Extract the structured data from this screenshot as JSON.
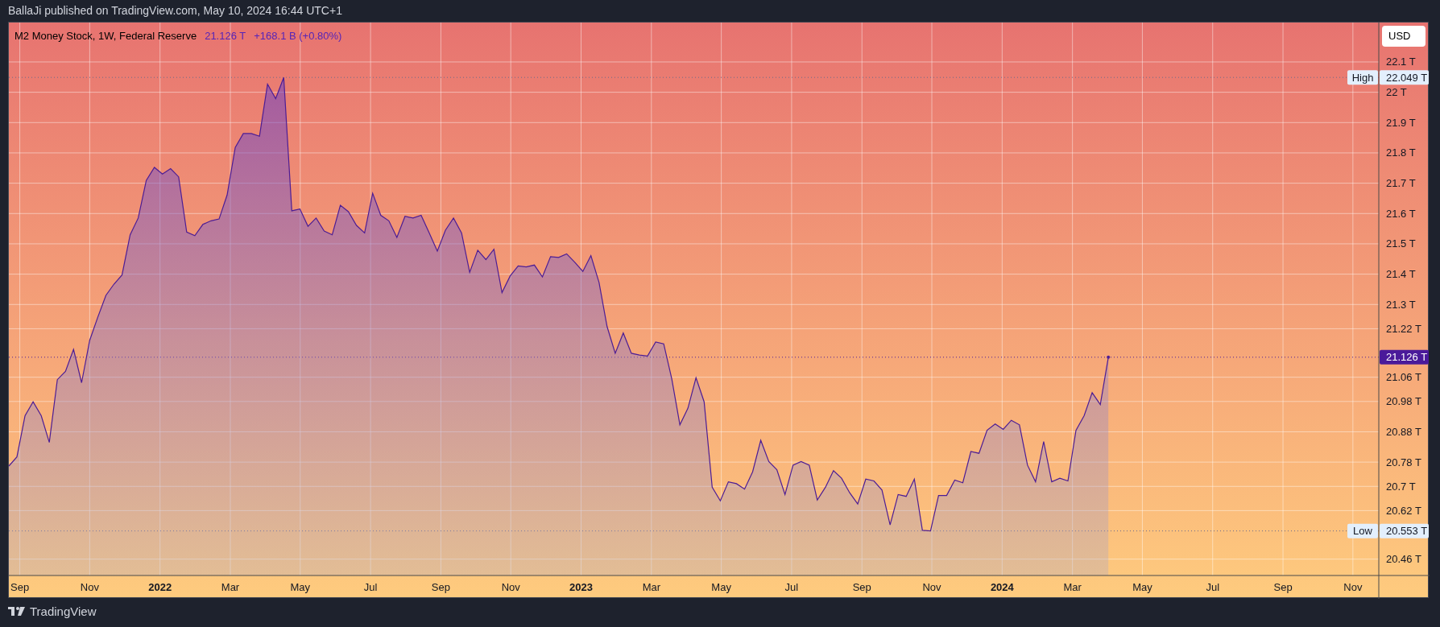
{
  "header": {
    "publisher_line": "BallaJi published on TradingView.com, May 10, 2024 16:44 UTC+1"
  },
  "chart": {
    "legend": {
      "last_value": "21.126 T",
      "change": "+168.1 B (+0.80%)"
    },
    "currency_button": "USD",
    "chart_data": {
      "type": "area",
      "x": [
        2021.641,
        2021.6602,
        2021.6794,
        2021.6986,
        2021.7178,
        2021.737,
        2021.7562,
        2021.7754,
        2021.7946,
        2021.8138,
        2021.833,
        2021.8522,
        2021.8714,
        2021.8906,
        2021.9098,
        2021.929,
        2021.9482,
        2021.9674,
        2021.9866,
        2022.0058,
        2022.025,
        2022.0442,
        2022.0634,
        2022.0826,
        2022.1018,
        2022.121,
        2022.1402,
        2022.1594,
        2022.1786,
        2022.1978,
        2022.217,
        2022.2362,
        2022.2554,
        2022.2746,
        2022.2938,
        2022.313,
        2022.3322,
        2022.3514,
        2022.3706,
        2022.3898,
        2022.409,
        2022.4282,
        2022.4474,
        2022.4666,
        2022.4858,
        2022.505,
        2022.5242,
        2022.5434,
        2022.5626,
        2022.5818,
        2022.601,
        2022.6202,
        2022.6394,
        2022.6586,
        2022.6778,
        2022.697,
        2022.7162,
        2022.7354,
        2022.7546,
        2022.7738,
        2022.793,
        2022.8122,
        2022.8314,
        2022.8506,
        2022.8698,
        2022.889,
        2022.9082,
        2022.9274,
        2022.9466,
        2022.9658,
        2022.985,
        2023.0042,
        2023.0234,
        2023.0426,
        2023.0618,
        2023.081,
        2023.1002,
        2023.1194,
        2023.1386,
        2023.1578,
        2023.177,
        2023.1962,
        2023.2154,
        2023.2346,
        2023.2538,
        2023.273,
        2023.2922,
        2023.3114,
        2023.3306,
        2023.3498,
        2023.369,
        2023.3882,
        2023.4074,
        2023.4266,
        2023.4458,
        2023.465,
        2023.4842,
        2023.5034,
        2023.5226,
        2023.5418,
        2023.561,
        2023.5802,
        2023.5994,
        2023.6186,
        2023.6378,
        2023.657,
        2023.6762,
        2023.6954,
        2023.7146,
        2023.7338,
        2023.753,
        2023.7722,
        2023.7914,
        2023.8106,
        2023.8298,
        2023.849,
        2023.8682,
        2023.8874,
        2023.9066,
        2023.9258,
        2023.945,
        2023.9642,
        2023.9834,
        2024.0026,
        2024.0218,
        2024.041,
        2024.0602,
        2024.0794,
        2024.0986,
        2024.1178,
        2024.137,
        2024.1562,
        2024.1754,
        2024.1946,
        2024.2138,
        2024.233,
        2024.2522
      ],
      "series": [
        {
          "name": "M2 Money Stock, 1W, Federal Reserve",
          "color": "#4c1d95",
          "values": [
            20.767,
            20.797,
            20.933,
            20.979,
            20.933,
            20.845,
            21.052,
            21.079,
            21.152,
            21.042,
            21.182,
            21.258,
            21.33,
            21.367,
            21.397,
            21.53,
            21.585,
            21.709,
            21.752,
            21.73,
            21.748,
            21.721,
            21.539,
            21.527,
            21.564,
            21.576,
            21.582,
            21.661,
            21.818,
            21.864,
            21.864,
            21.855,
            22.027,
            21.979,
            22.049,
            21.609,
            21.615,
            21.558,
            21.585,
            21.542,
            21.53,
            21.627,
            21.606,
            21.561,
            21.536,
            21.667,
            21.594,
            21.576,
            21.521,
            21.591,
            21.585,
            21.594,
            21.536,
            21.476,
            21.545,
            21.585,
            21.536,
            21.406,
            21.479,
            21.448,
            21.482,
            21.339,
            21.394,
            21.427,
            21.424,
            21.43,
            21.391,
            21.458,
            21.455,
            21.467,
            21.439,
            21.409,
            21.461,
            21.373,
            21.227,
            21.139,
            21.206,
            21.139,
            21.133,
            21.13,
            21.176,
            21.17,
            21.055,
            20.903,
            20.958,
            21.058,
            20.979,
            20.697,
            20.652,
            20.715,
            20.709,
            20.691,
            20.748,
            20.852,
            20.782,
            20.755,
            20.673,
            20.77,
            20.782,
            20.77,
            20.655,
            20.697,
            20.752,
            20.727,
            20.679,
            20.642,
            20.724,
            20.718,
            20.688,
            20.573,
            20.673,
            20.667,
            20.724,
            20.555,
            20.553,
            20.67,
            20.67,
            20.721,
            20.712,
            20.815,
            20.809,
            20.885,
            20.906,
            20.888,
            20.918,
            20.903,
            20.77,
            20.715,
            20.848,
            20.715,
            20.727,
            20.718,
            20.885,
            20.933,
            21.009,
            20.97,
            21.126
          ]
        }
      ],
      "xlim": [
        2021.641,
        2025.015
      ],
      "ylim": [
        20.406,
        22.23
      ],
      "xticks": [
        {
          "value": 2021.667,
          "label": "Sep"
        },
        {
          "value": 2021.833,
          "label": "Nov"
        },
        {
          "value": 2022,
          "label": "2022"
        },
        {
          "value": 2022.167,
          "label": "Mar"
        },
        {
          "value": 2022.333,
          "label": "May"
        },
        {
          "value": 2022.5,
          "label": "Jul"
        },
        {
          "value": 2022.667,
          "label": "Sep"
        },
        {
          "value": 2022.833,
          "label": "Nov"
        },
        {
          "value": 2023,
          "label": "2023"
        },
        {
          "value": 2023.167,
          "label": "Mar"
        },
        {
          "value": 2023.333,
          "label": "May"
        },
        {
          "value": 2023.5,
          "label": "Jul"
        },
        {
          "value": 2023.667,
          "label": "Sep"
        },
        {
          "value": 2023.833,
          "label": "Nov"
        },
        {
          "value": 2024,
          "label": "2024"
        },
        {
          "value": 2024.167,
          "label": "Mar"
        },
        {
          "value": 2024.333,
          "label": "May"
        },
        {
          "value": 2024.5,
          "label": "Jul"
        },
        {
          "value": 2024.667,
          "label": "Sep"
        },
        {
          "value": 2024.833,
          "label": "Nov"
        }
      ],
      "yticks": [
        {
          "value": 22.1,
          "label": "22.1 T"
        },
        {
          "value": 22.0,
          "label": "22 T"
        },
        {
          "value": 21.9,
          "label": "21.9 T"
        },
        {
          "value": 21.8,
          "label": "21.8 T"
        },
        {
          "value": 21.7,
          "label": "21.7 T"
        },
        {
          "value": 21.6,
          "label": "21.6 T"
        },
        {
          "value": 21.5,
          "label": "21.5 T"
        },
        {
          "value": 21.4,
          "label": "21.4 T"
        },
        {
          "value": 21.3,
          "label": "21.3 T"
        },
        {
          "value": 21.22,
          "label": "21.22 T"
        },
        {
          "value": 21.06,
          "label": "21.06 T"
        },
        {
          "value": 20.98,
          "label": "20.98 T"
        },
        {
          "value": 20.88,
          "label": "20.88 T"
        },
        {
          "value": 20.78,
          "label": "20.78 T"
        },
        {
          "value": 20.7,
          "label": "20.7 T"
        },
        {
          "value": 20.62,
          "label": "20.62 T"
        },
        {
          "value": 20.46,
          "label": "20.46 T"
        }
      ],
      "grid": true,
      "ref_lines": [
        {
          "axis": "y",
          "value": 22.049,
          "color": "#6b6b8a"
        },
        {
          "axis": "y",
          "value": 21.126,
          "color": "#4c1d95"
        },
        {
          "axis": "y",
          "value": 20.553,
          "color": "#6b6b8a"
        }
      ]
    },
    "price_markers": [
      {
        "kind": "high",
        "label": "High",
        "value": "22.049 T"
      },
      {
        "kind": "last",
        "value": "21.126 T"
      },
      {
        "kind": "low",
        "label": "Low",
        "value": "20.553 T"
      }
    ]
  },
  "footer": {
    "logo_text": "TradingView"
  }
}
